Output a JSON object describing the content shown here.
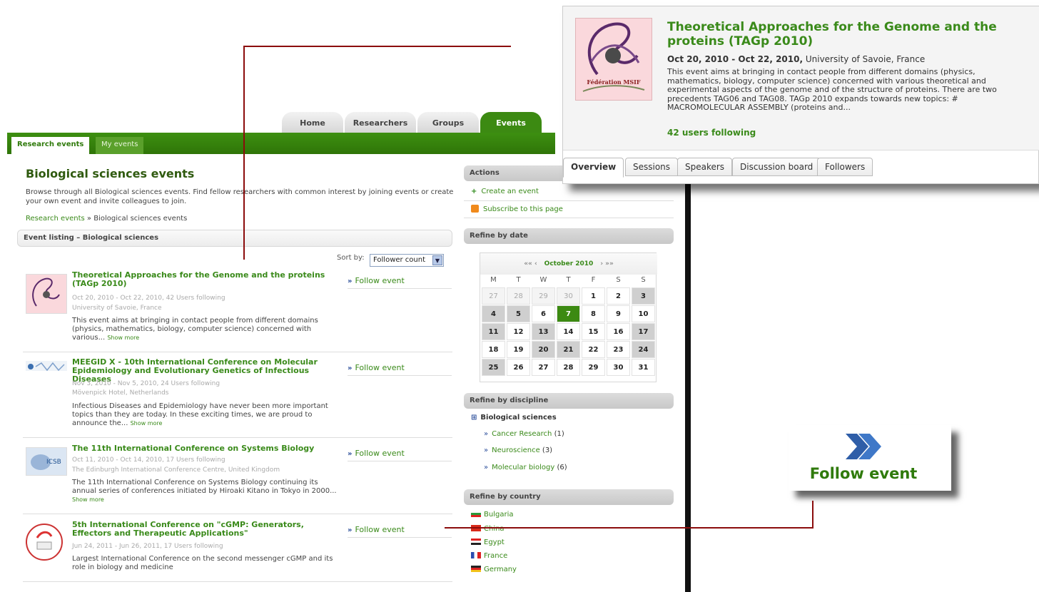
{
  "topnav": {
    "tabs": [
      "Home",
      "Researchers",
      "Groups",
      "Events"
    ]
  },
  "subnav": {
    "tabs": [
      "Research events",
      "My events"
    ]
  },
  "page": {
    "title": "Biological sciences events",
    "description": "Browse through all Biological sciences events. Find fellow researchers with common interest by joining events or create your own event and invite colleagues to join.",
    "breadcrumb": {
      "link": "Research events",
      "separator": " » ",
      "current": "Biological sciences events"
    },
    "listing_header": "Event listing – Biological sciences",
    "sort_label": "Sort by:",
    "sort_value": "Follower count"
  },
  "events": [
    {
      "title": "Theoretical Approaches for the Genome and the proteins (TAGp 2010)",
      "dates": "Oct 20, 2010 - Oct 22, 2010, 42 Users following",
      "venue": "University of Savoie, France",
      "text": "This event aims at bringing in contact people from different domains (physics, mathematics, biology, computer science) concerned with various...",
      "more": "Show more",
      "follow": "Follow event"
    },
    {
      "title": "MEEGID X - 10th International Conference on Molecular Epidemiology and Evolutionary Genetics of Infectious Diseases",
      "dates": "Nov 3, 2010 - Nov 5, 2010, 24 Users following",
      "venue": "Mövenpick Hotel, Netherlands",
      "text": "Infectious Diseases and Epidemiology have never been more important topics than they are today. In these exciting times, we are proud to announce the...",
      "more": "Show more",
      "follow": "Follow event"
    },
    {
      "title": "The 11th International Conference on Systems Biology",
      "dates": "Oct 11, 2010 - Oct 14, 2010, 17 Users following",
      "venue": "The Edinburgh International Conference Centre, United Kingdom",
      "text": "The 11th International Conference on Systems Biology continuing its annual series of conferences initiated by Hiroaki Kitano in Tokyo in 2000...",
      "more": "Show more",
      "follow": "Follow event"
    },
    {
      "title": "5th International Conference on \"cGMP: Generators, Effectors and Therapeutic Applications\"",
      "dates": "Jun 24, 2011 - Jun 26, 2011, 17 Users following",
      "venue": "",
      "text": "Largest International Conference on the second messenger cGMP and its role in biology and medicine",
      "more": "",
      "follow": "Follow event"
    }
  ],
  "sidebar": {
    "actions_title": "Actions",
    "actions": [
      "Create an event",
      "Subscribe to this page"
    ],
    "date_title": "Refine by date",
    "calendar": {
      "month": "October 2010",
      "nav_prev": "«« ‹",
      "nav_next": "› »»",
      "days": [
        "M",
        "T",
        "W",
        "T",
        "F",
        "S",
        "S"
      ],
      "weeks": [
        [
          "27",
          "28",
          "29",
          "30",
          "1",
          "2",
          "3"
        ],
        [
          "4",
          "5",
          "6",
          "7",
          "8",
          "9",
          "10"
        ],
        [
          "11",
          "12",
          "13",
          "14",
          "15",
          "16",
          "17"
        ],
        [
          "18",
          "19",
          "20",
          "21",
          "22",
          "23",
          "24"
        ],
        [
          "25",
          "26",
          "27",
          "28",
          "29",
          "30",
          "31"
        ]
      ],
      "selected": "7"
    },
    "discipline_title": "Refine by discipline",
    "discipline_root": "Biological sciences",
    "disciplines": [
      {
        "name": "Cancer Research",
        "count": "(1)"
      },
      {
        "name": "Neuroscience",
        "count": "(3)"
      },
      {
        "name": "Molecular biology",
        "count": "(6)"
      }
    ],
    "country_title": "Refine by country",
    "countries": [
      "Bulgaria",
      "China",
      "Egypt",
      "France",
      "Germany"
    ]
  },
  "detail_card": {
    "title": "Theoretical Approaches for the Genome and the proteins (TAGp 2010)",
    "dates": "Oct 20, 2010 - Oct 22, 2010,",
    "venue": " University of Savoie, France",
    "text": "This event aims at bringing in contact people from different domains (physics, mathematics, biology, computer science) concerned with various theoretical and experimental aspects of the genome and of the structure of proteins. There are two precedents TAG06 and TAG08. TAGp 2010 expands towards new topics: # MACROMOLECULAR ASSEMBLY (proteins and...",
    "following": "42 users following",
    "logo_text": "Fédération MSIF",
    "tabs": [
      "Overview",
      "Sessions",
      "Speakers",
      "Discussion board",
      "Followers"
    ]
  },
  "zoom_callout": {
    "label": "Follow event"
  },
  "colors": {
    "brand_green": "#3c8a12",
    "link_green": "#3a8a1a",
    "connector": "#8b0c0c"
  }
}
